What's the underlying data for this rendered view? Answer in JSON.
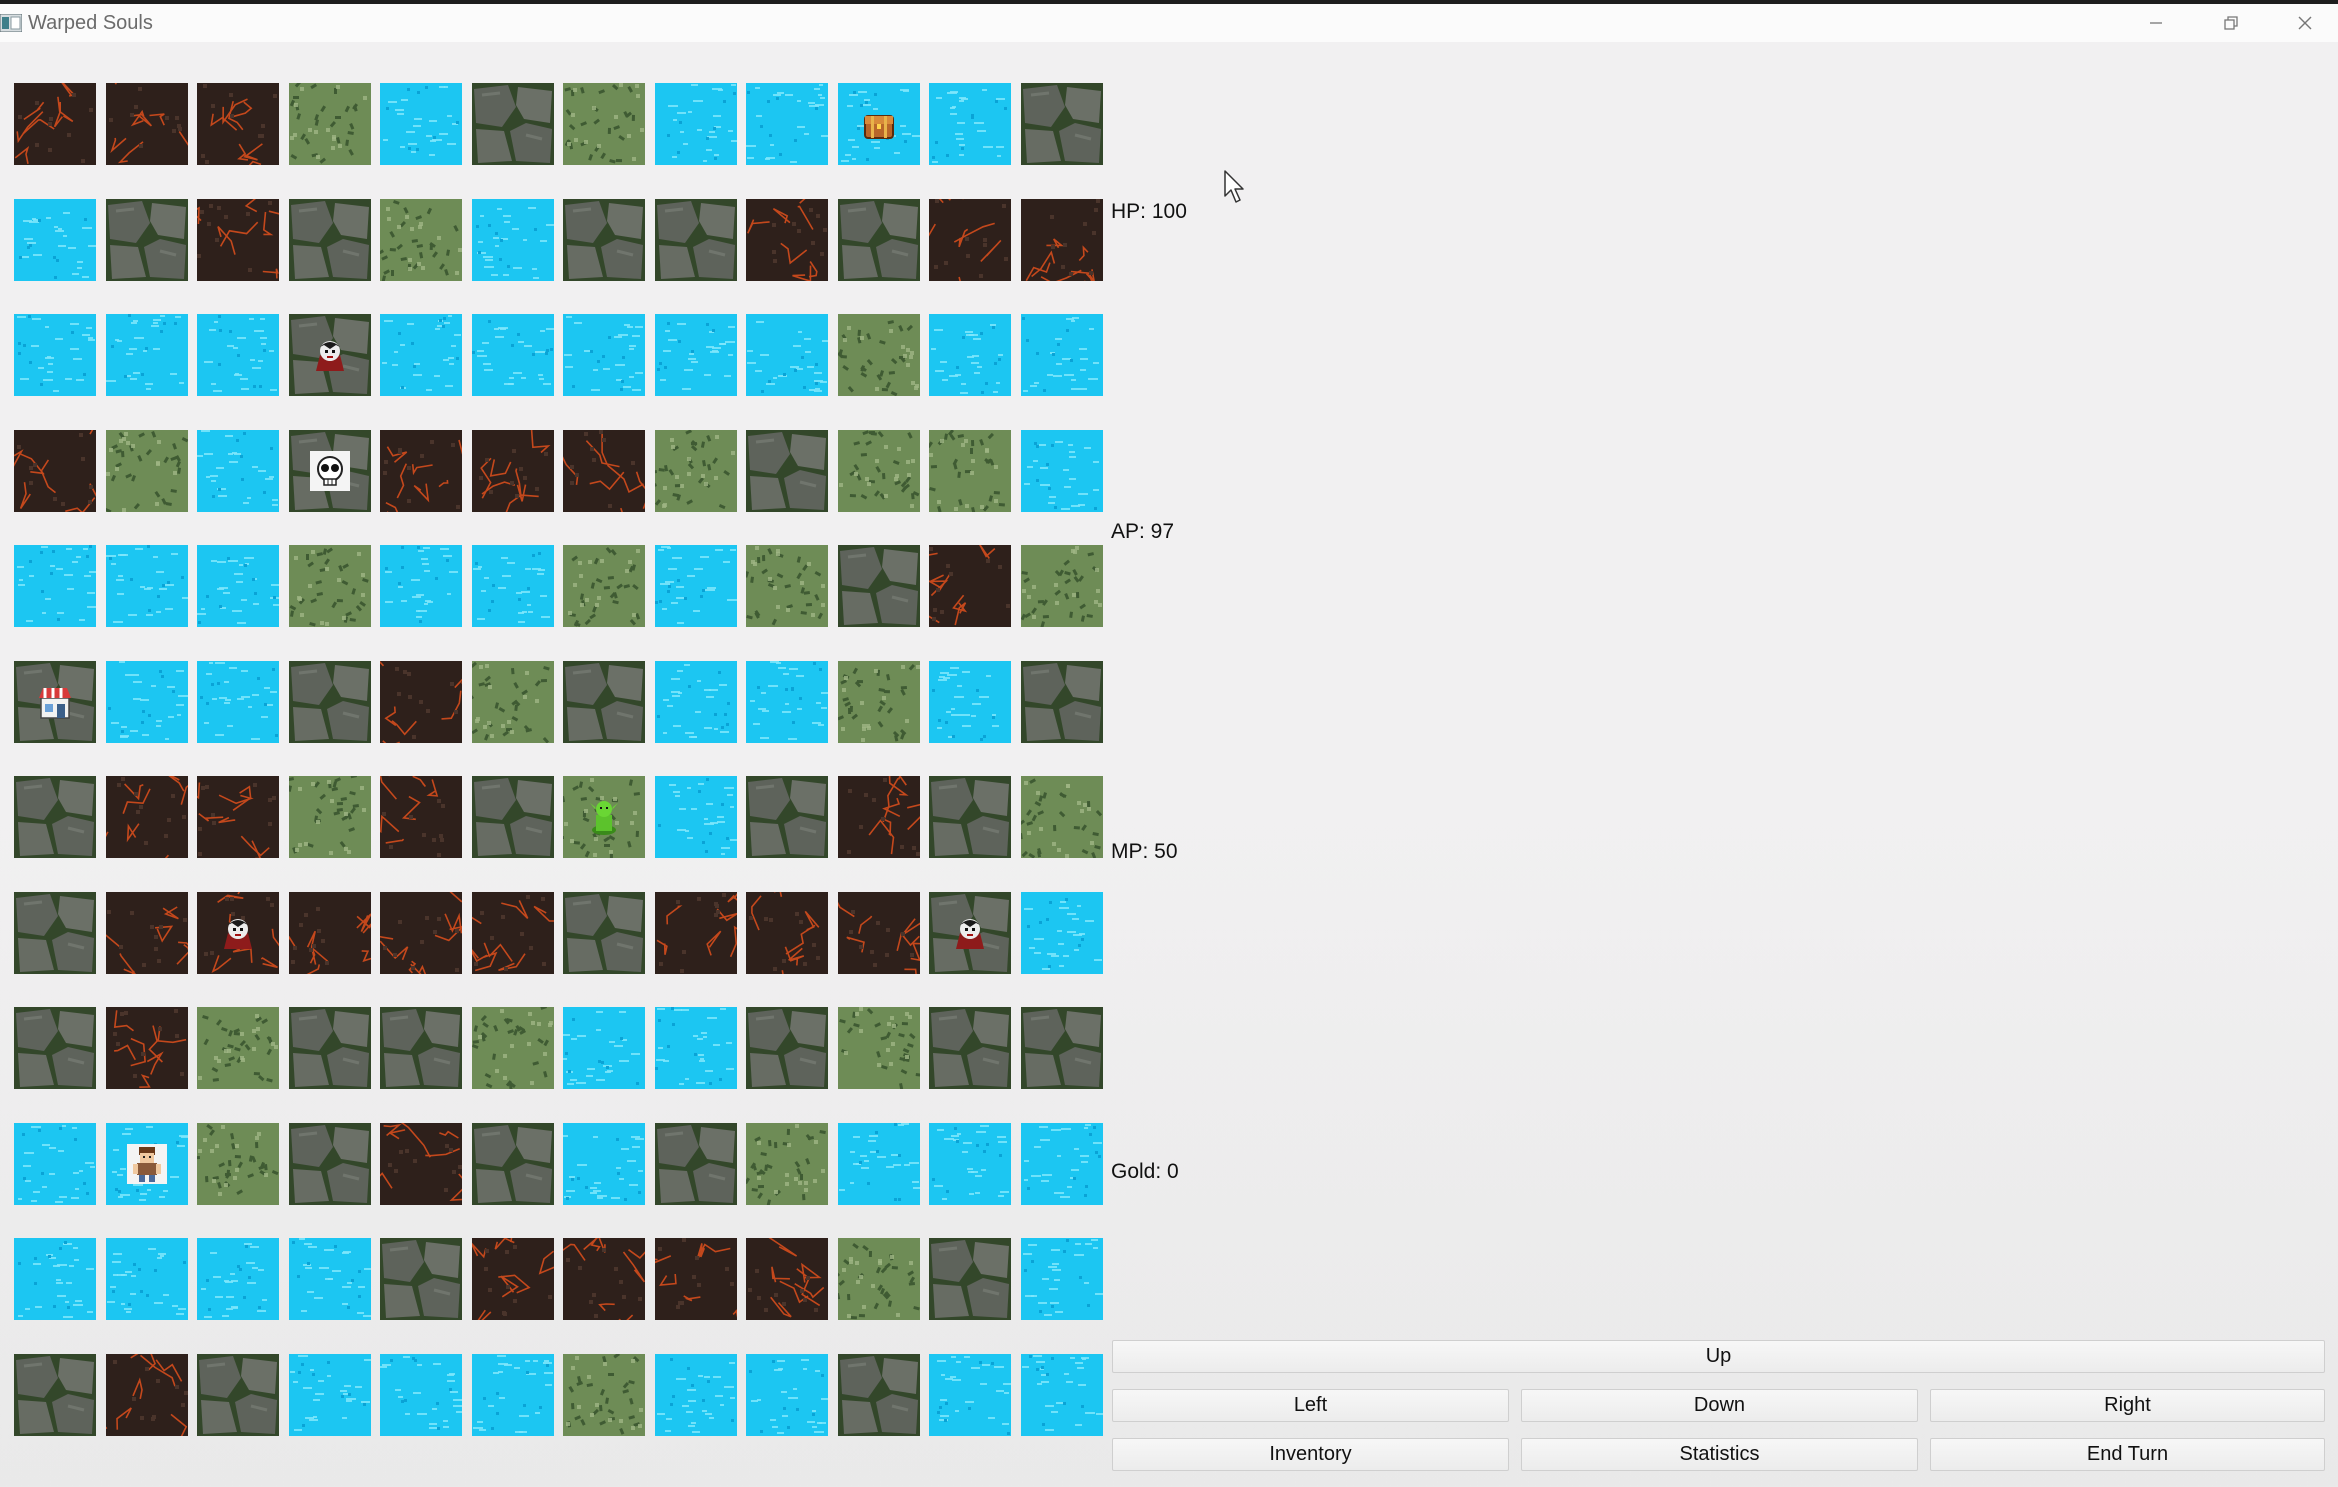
{
  "window": {
    "title": "Warped Souls"
  },
  "map": {
    "legend": {
      "L": "lava-tile",
      "S": "stone-tile",
      "G": "grass-tile",
      "W": "water-tile"
    },
    "rows": [
      "LLLGWSGWWWWS",
      "WSLSGWSSLSLL",
      "WWWSWWWWWGWW",
      "LGWSLLLGSGGW",
      "WWWGWWGWGSLG",
      "SWWSLGSWWGWS",
      "SLLGLSGWSLSG",
      "SLLLLLSLLLSW",
      "SLGSSGWWSGSS",
      "WWGSLSWSGWWW",
      "WWWWSLLLLGSW",
      "SLSWWWGWWSWW"
    ],
    "entities": [
      {
        "type": "treasure-chest",
        "row": 0,
        "col": 9
      },
      {
        "type": "vampire",
        "row": 2,
        "col": 3
      },
      {
        "type": "skull",
        "row": 3,
        "col": 3
      },
      {
        "type": "shop",
        "row": 5,
        "col": 0
      },
      {
        "type": "goblin",
        "row": 6,
        "col": 6
      },
      {
        "type": "vampire",
        "row": 7,
        "col": 2
      },
      {
        "type": "vampire",
        "row": 7,
        "col": 10
      },
      {
        "type": "player-hero",
        "row": 9,
        "col": 1
      }
    ]
  },
  "stats": {
    "hp": "HP: 100",
    "ap": "AP: 97",
    "mp": "MP: 50",
    "gold": "Gold: 0"
  },
  "controls": {
    "up": "Up",
    "left": "Left",
    "down": "Down",
    "right": "Right",
    "inventory": "Inventory",
    "statistics": "Statistics",
    "end_turn": "End Turn"
  },
  "colors": {
    "lava_base": "#2e201b",
    "lava_crack": "#c4481c",
    "stone_base": "#5e635b",
    "stone_moss": "#33472a",
    "grass_base": "#6e8c56",
    "grass_dark": "#3f5b33",
    "water_base": "#1cc6f2",
    "water_light": "#7fe6fb"
  }
}
